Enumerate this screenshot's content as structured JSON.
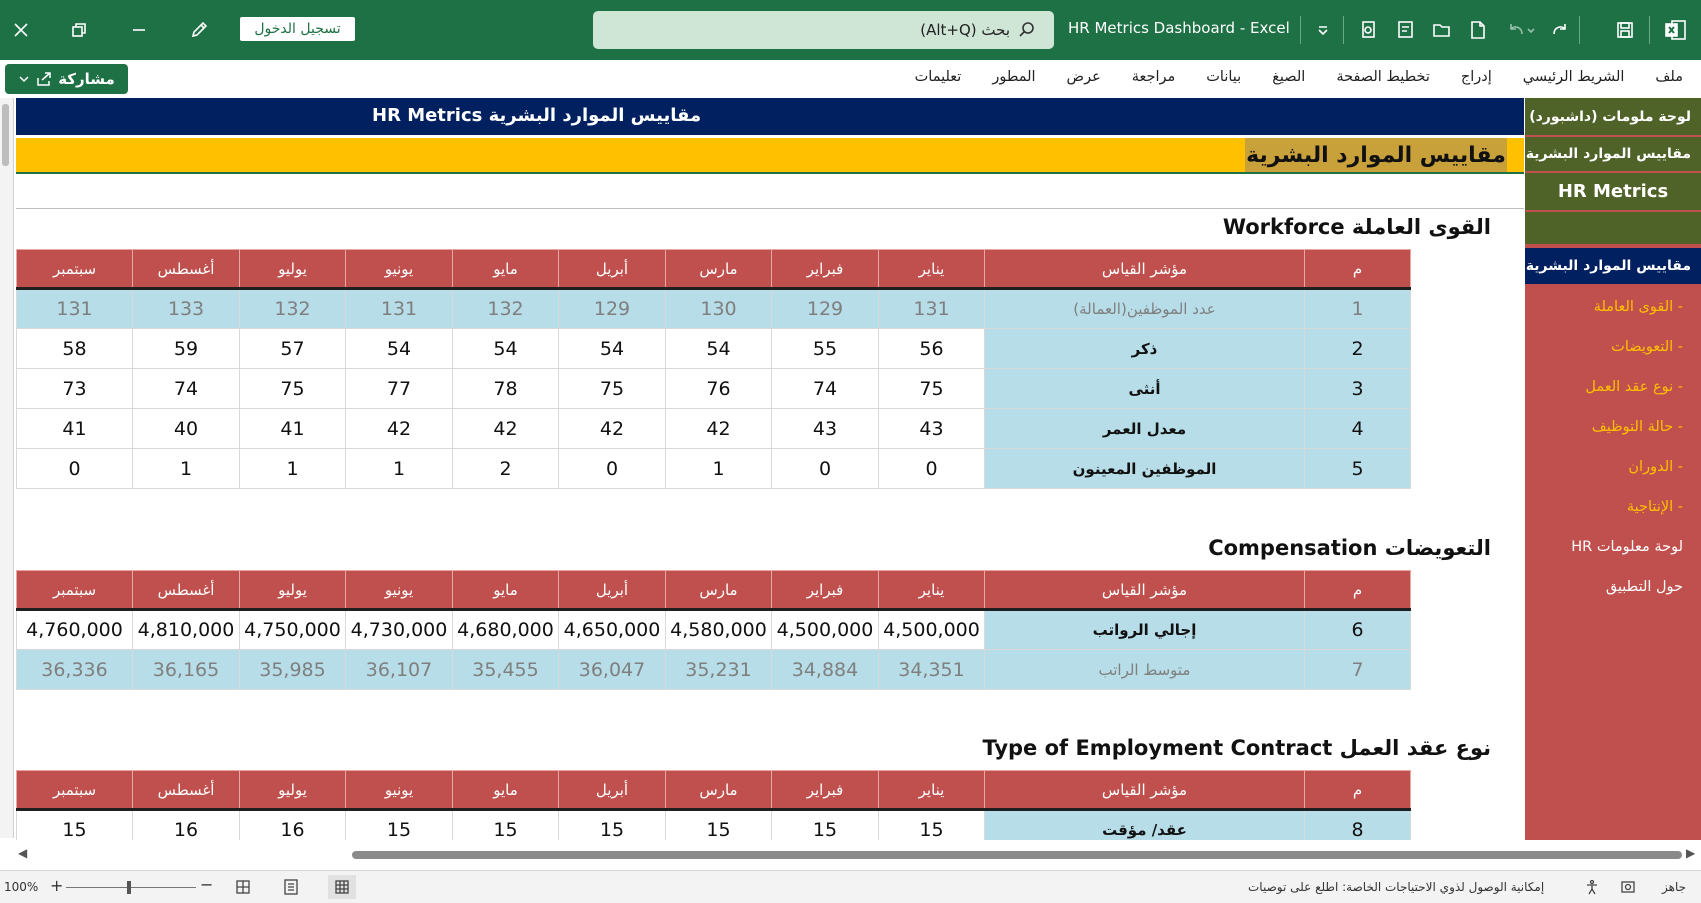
{
  "titlebar": {
    "login_label": "تسجيل الدخول",
    "search_placeholder": "بحث (Alt+Q)",
    "doc_title": "HR Metrics Dashboard  -  Excel",
    "app_icon": "excel-icon"
  },
  "menu": {
    "share_label": "مشاركة",
    "items": [
      "ملف",
      "الشريط الرئيسي",
      "إدراج",
      "تخطيط الصفحة",
      "الصيغ",
      "بيانات",
      "مراجعة",
      "عرض",
      "المطور",
      "تعليمات"
    ]
  },
  "nav": {
    "header1": "لوحة ملومات (داشبورد)",
    "header2": "مقاييس الموارد البشرية",
    "header3": "HR Metrics",
    "section": "مقاييس الموارد البشرية",
    "links": [
      "- القوى العاملة",
      "- التعويضات",
      "- نوع عقد العمل",
      "- حالة التوظيف",
      "- الدوران",
      "- الإنتاجية"
    ],
    "footer1": "لوحة معلومات HR",
    "footer2": "حول التطبيق"
  },
  "banner": {
    "blue_title": "مقاييس الموارد البشرية HR Metrics",
    "gold_title": "مقاييس الموارد البشرية"
  },
  "columns": {
    "num": "م",
    "metric": "مؤشر القياس",
    "months": [
      "يناير",
      "فبراير",
      "مارس",
      "أبريل",
      "مايو",
      "يونيو",
      "يوليو",
      "أغسطس",
      "سبتمبر"
    ]
  },
  "sections": {
    "workforce": {
      "title": "القوى العاملة Workforce",
      "rows": [
        {
          "n": "1",
          "label": "عدد الموظفين(العمالة)",
          "muted": true,
          "values": [
            "131",
            "129",
            "130",
            "129",
            "132",
            "131",
            "132",
            "133",
            "131"
          ]
        },
        {
          "n": "2",
          "label": "ذكر",
          "values": [
            "56",
            "55",
            "54",
            "54",
            "54",
            "54",
            "57",
            "59",
            "58"
          ]
        },
        {
          "n": "3",
          "label": "أنثى",
          "values": [
            "75",
            "74",
            "76",
            "75",
            "78",
            "77",
            "75",
            "74",
            "73"
          ]
        },
        {
          "n": "4",
          "label": "معدل العمر",
          "values": [
            "43",
            "43",
            "42",
            "42",
            "42",
            "42",
            "41",
            "40",
            "41"
          ]
        },
        {
          "n": "5",
          "label": "الموظفين المعينون",
          "values": [
            "0",
            "0",
            "1",
            "0",
            "2",
            "1",
            "1",
            "1",
            "0"
          ]
        }
      ]
    },
    "compensation": {
      "title": "التعويضات Compensation",
      "rows": [
        {
          "n": "6",
          "label": "إجالي الرواتب",
          "values": [
            "4,500,000",
            "4,500,000",
            "4,580,000",
            "4,650,000",
            "4,680,000",
            "4,730,000",
            "4,750,000",
            "4,810,000",
            "4,760,000"
          ]
        },
        {
          "n": "7",
          "label": "متوسط الراتب",
          "muted": true,
          "values": [
            "34,351",
            "34,884",
            "35,231",
            "36,047",
            "35,455",
            "36,107",
            "35,985",
            "36,165",
            "36,336"
          ]
        }
      ]
    },
    "contract": {
      "title": "نوع عقد العمل Type of Employment Contract",
      "rows": [
        {
          "n": "8",
          "label": "عقد/ مؤقت",
          "values": [
            "15",
            "15",
            "15",
            "15",
            "15",
            "15",
            "16",
            "16",
            "15"
          ]
        }
      ]
    }
  },
  "status": {
    "ready": "جاهز",
    "accessibility": "إمكانية الوصول لذوي الاحتياجات الخاصة: اطلع على توصيات",
    "zoom": "100%"
  },
  "colors": {
    "excel_green": "#1e7145",
    "header_red": "#c0504d",
    "cell_blue": "#b7dde8",
    "navy": "#002060",
    "gold": "#ffc000",
    "nav_link": "#ffc000"
  }
}
